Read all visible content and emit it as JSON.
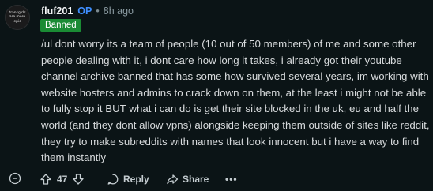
{
  "comment": {
    "avatar_lines": [
      "transgirls",
      "are more",
      "epic"
    ],
    "username": "fluf201",
    "op_label": "OP",
    "separator": "•",
    "time": "8h ago",
    "flair": "Banned",
    "text": "/ul dont worry its a team of people (10 out of 50 members) of me and some other people dealing with it, i dont care how long it takes, i already got their youtube channel archive banned that has some how survived several years, im working with website hosters and admins to crack down on them, at the least i might not be able to fully stop it BUT what i can do is get their site blocked in the uk, eu and half the world (and they dont allow vpns) alongside keeping them outside of sites like reddit, they try to make subreddits with names that look innocent but i have a way to find them instantly"
  },
  "actions": {
    "vote_count": "47",
    "reply_label": "Reply",
    "share_label": "Share",
    "more_label": "•••",
    "collapse_icon": "collapse-minus-icon",
    "upvote_icon": "upvote-arrow-icon",
    "downvote_icon": "downvote-arrow-icon",
    "reply_icon": "speech-bubble-icon",
    "share_icon": "share-arrow-icon"
  },
  "colors": {
    "background": "#0b1416",
    "op": "#3f8fff",
    "flair_bg": "#1a8b34",
    "text": "#d7dadc"
  }
}
